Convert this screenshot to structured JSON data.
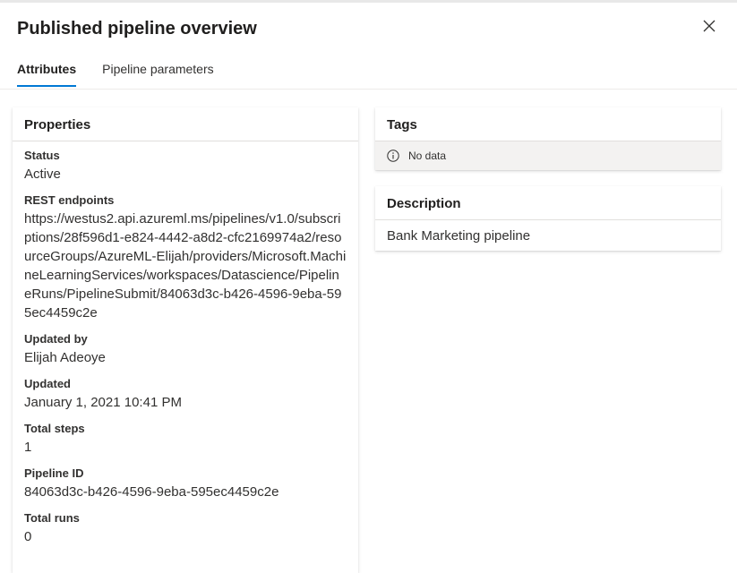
{
  "panel": {
    "title": "Published pipeline overview",
    "close_icon": "close-icon"
  },
  "tabs": [
    {
      "label": "Attributes",
      "selected": true
    },
    {
      "label": "Pipeline parameters",
      "selected": false
    }
  ],
  "properties": {
    "header": "Properties",
    "items": [
      {
        "label": "Status",
        "value": "Active"
      },
      {
        "label": "REST endpoints",
        "value": "https://westus2.api.azureml.ms/pipelines/v1.0/subscriptions/28f596d1-e824-4442-a8d2-cfc2169974a2/resourceGroups/AzureML-Elijah/providers/Microsoft.MachineLearningServices/workspaces/Datascience/PipelineRuns/PipelineSubmit/84063d3c-b426-4596-9eba-595ec4459c2e"
      },
      {
        "label": "Updated by",
        "value": "Elijah Adeoye"
      },
      {
        "label": "Updated",
        "value": "January 1, 2021 10:41 PM"
      },
      {
        "label": "Total steps",
        "value": "1"
      },
      {
        "label": "Pipeline ID",
        "value": "84063d3c-b426-4596-9eba-595ec4459c2e"
      },
      {
        "label": "Total runs",
        "value": "0"
      }
    ]
  },
  "tags": {
    "header": "Tags",
    "empty_text": "No data",
    "empty_icon": "info-icon"
  },
  "description": {
    "header": "Description",
    "text": "Bank Marketing pipeline"
  },
  "colors": {
    "accent": "#0078d4",
    "text": "#323130",
    "empty_row_bg": "#f3f2f1"
  }
}
